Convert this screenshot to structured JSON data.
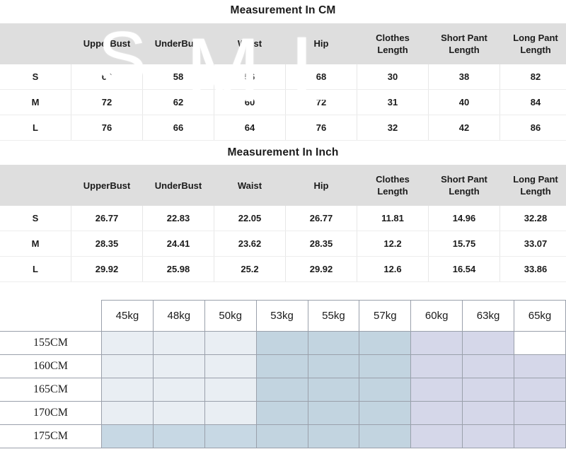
{
  "cm_table": {
    "title": "Measurement In CM",
    "headers": [
      "",
      "UpperBust",
      "UnderBust",
      "Waist",
      "Hip",
      "Clothes\nLength",
      "Short Pant\nLength",
      "Long Pant\nLength"
    ],
    "rows": [
      [
        "S",
        "68",
        "58",
        "56",
        "68",
        "30",
        "38",
        "82"
      ],
      [
        "M",
        "72",
        "62",
        "60",
        "72",
        "31",
        "40",
        "84"
      ],
      [
        "L",
        "76",
        "66",
        "64",
        "76",
        "32",
        "42",
        "86"
      ]
    ]
  },
  "inch_table": {
    "title": "Measurement In Inch",
    "headers": [
      "",
      "UpperBust",
      "UnderBust",
      "Waist",
      "Hip",
      "Clothes\nLength",
      "Short Pant\nLength",
      "Long Pant\nLength"
    ],
    "rows": [
      [
        "S",
        "26.77",
        "22.83",
        "22.05",
        "26.77",
        "11.81",
        "14.96",
        "32.28"
      ],
      [
        "M",
        "28.35",
        "24.41",
        "23.62",
        "28.35",
        "12.2",
        "15.75",
        "33.07"
      ],
      [
        "L",
        "29.92",
        "25.98",
        "25.2",
        "29.92",
        "12.6",
        "16.54",
        "33.86"
      ]
    ]
  },
  "size_matrix": {
    "corner_label": "",
    "weights": [
      "45kg",
      "48kg",
      "50kg",
      "53kg",
      "55kg",
      "57kg",
      "60kg",
      "63kg",
      "65kg"
    ],
    "heights": [
      "155CM",
      "160CM",
      "165CM",
      "170CM",
      "175CM"
    ],
    "watermarks": [
      "S",
      "M",
      "L"
    ],
    "cell_shading": [
      [
        "s",
        "s",
        "s",
        "m",
        "m",
        "m",
        "l",
        "l",
        "blank"
      ],
      [
        "s",
        "s",
        "s",
        "m",
        "m",
        "m",
        "l",
        "l",
        "l"
      ],
      [
        "s",
        "s",
        "s",
        "m",
        "m",
        "m",
        "l",
        "l",
        "l"
      ],
      [
        "s",
        "s",
        "s",
        "m",
        "m",
        "m",
        "l",
        "l",
        "l"
      ],
      [
        "s-deep",
        "s-deep",
        "s-deep",
        "m",
        "m",
        "m",
        "l",
        "l",
        "l"
      ]
    ],
    "colors": {
      "small": "#e9eef3",
      "small_deep": "#c7d8e4",
      "medium": "#c2d4e0",
      "large": "#d5d7e9",
      "grid_line": "#9aa0ab",
      "header_fill": "#dedede"
    }
  }
}
